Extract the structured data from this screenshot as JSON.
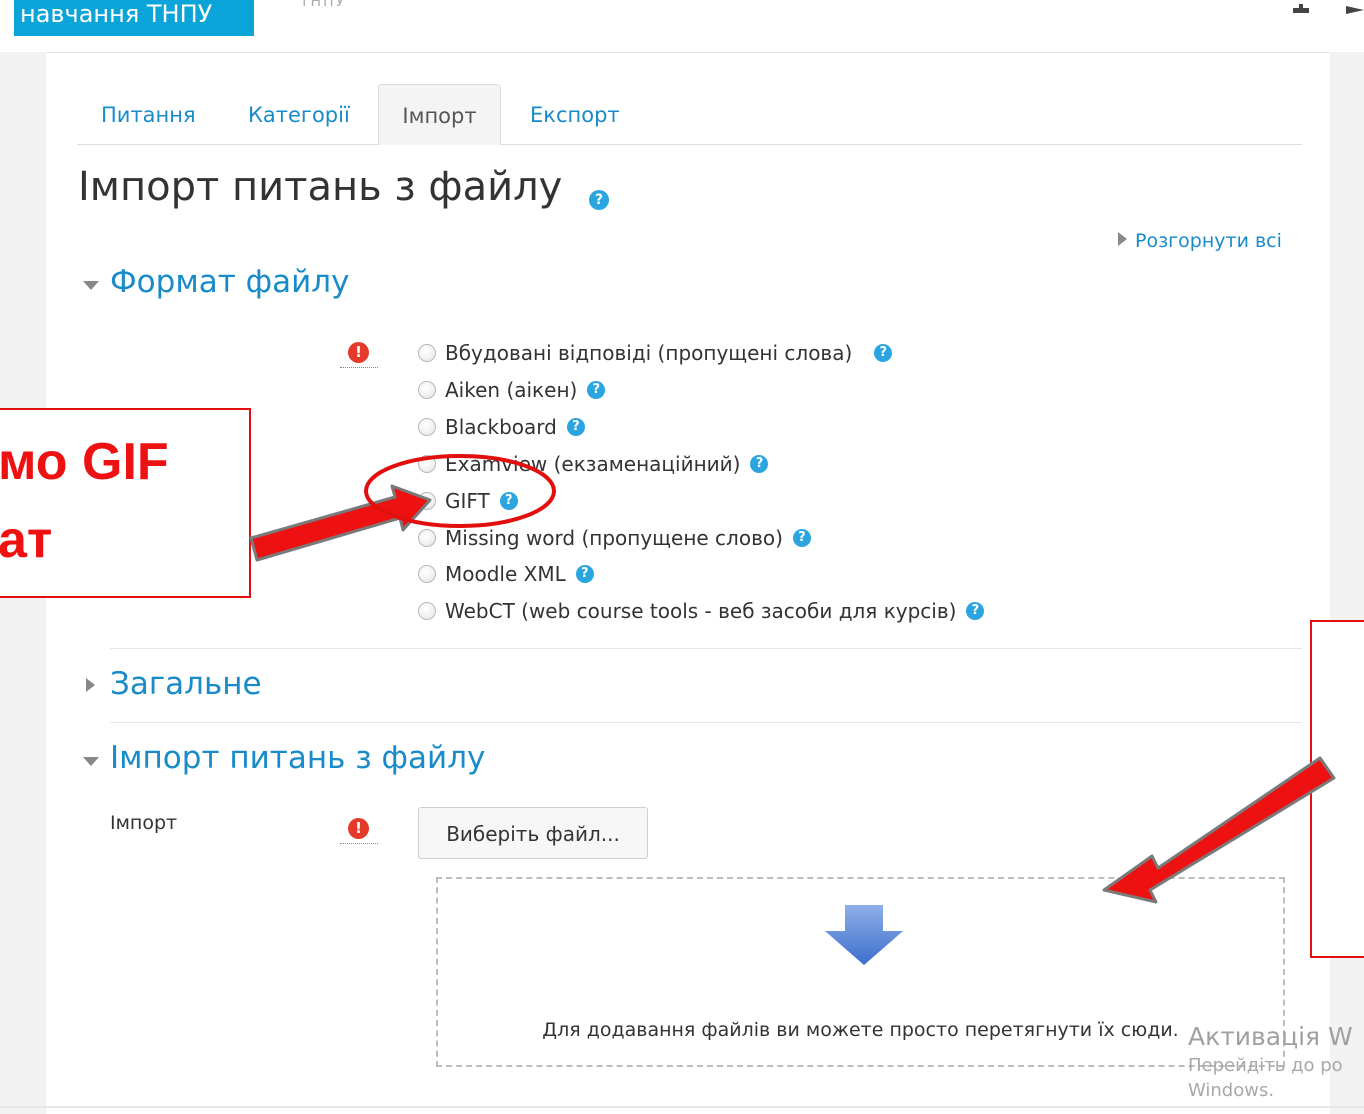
{
  "topbar": {
    "brand": "навчання ТНПУ",
    "menu_text": "ТНПУ"
  },
  "tabs": [
    {
      "label": "Питання",
      "active": false
    },
    {
      "label": "Категорії",
      "active": false
    },
    {
      "label": "Імпорт",
      "active": true
    },
    {
      "label": "Експорт",
      "active": false
    }
  ],
  "page": {
    "title": "Імпорт питань з файлу",
    "expand_all": "Розгорнути всі"
  },
  "sections": {
    "format": {
      "header": "Формат файлу",
      "options": [
        "Вбудовані відповіді (пропущені слова)",
        "Aiken (аікен)",
        "Blackboard",
        "Examview (екзаменаційний)",
        "GIFT",
        "Missing word (пропущене слово)",
        "Moodle XML",
        "WebCT (web course tools - веб засоби для курсів)"
      ]
    },
    "general": {
      "header": "Загальне"
    },
    "import": {
      "header": "Імпорт питань з файлу",
      "field_label": "Імпорт",
      "choose_button": "Виберіть файл...",
      "drop_text": "Для додавання файлів ви можете просто перетягнути їх сюди."
    }
  },
  "annotation": {
    "callout_line1": "мо GIF",
    "callout_line2": "ат",
    "highlight_color": "#e20f0f"
  },
  "watermark": {
    "line1": "Активація W",
    "line2": "Перейдіть до ро",
    "line3": "Windows."
  },
  "colors": {
    "brand": "#0aa4d8",
    "link": "#1a8bc9",
    "required": "#e53a2a",
    "help": "#2ba5e0"
  }
}
